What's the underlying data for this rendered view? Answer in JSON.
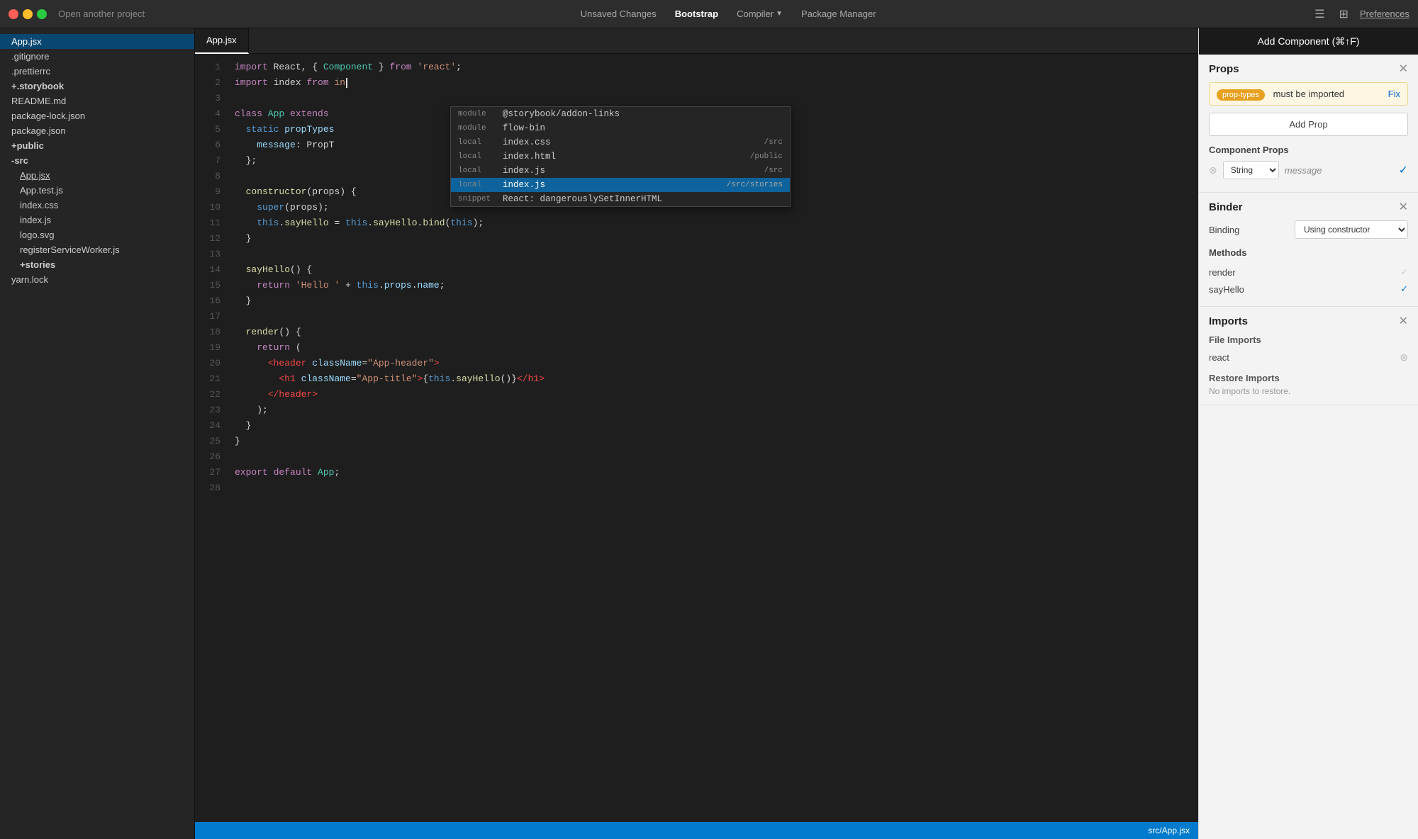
{
  "titlebar": {
    "open_project": "Open another project",
    "tabs": [
      {
        "label": "Unsaved Changes",
        "active": false
      },
      {
        "label": "Bootstrap",
        "active": true
      },
      {
        "label": "Compiler",
        "active": false,
        "has_arrow": true
      },
      {
        "label": "Package Manager",
        "active": false
      }
    ],
    "preferences": "Preferences"
  },
  "sidebar": {
    "items": [
      {
        "label": "App.jsx",
        "level": 0,
        "active": true
      },
      {
        "label": ".gitignore",
        "level": 0
      },
      {
        "label": ".prettierrc",
        "level": 0
      },
      {
        "label": "+.storybook",
        "level": 0,
        "bold": true
      },
      {
        "label": "README.md",
        "level": 0
      },
      {
        "label": "package-lock.json",
        "level": 0
      },
      {
        "label": "package.json",
        "level": 0
      },
      {
        "label": "+public",
        "level": 0,
        "bold": true
      },
      {
        "label": "-src",
        "level": 0,
        "bold": true
      },
      {
        "label": "App.jsx",
        "level": 1,
        "underline": true
      },
      {
        "label": "App.test.js",
        "level": 1
      },
      {
        "label": "index.css",
        "level": 1
      },
      {
        "label": "index.js",
        "level": 1
      },
      {
        "label": "logo.svg",
        "level": 1
      },
      {
        "label": "registerServiceWorker.js",
        "level": 1
      },
      {
        "label": "+stories",
        "level": 1,
        "bold": true
      },
      {
        "label": "yarn.lock",
        "level": 0
      }
    ]
  },
  "editor": {
    "filename": "App.jsx",
    "status_path": "src/App.jsx",
    "lines": [
      {
        "num": 1,
        "code": "import_react_component"
      },
      {
        "num": 2,
        "code": "import_index"
      },
      {
        "num": 3,
        "code": ""
      },
      {
        "num": 4,
        "code": "class_app_extends"
      },
      {
        "num": 5,
        "code": "static_proptypes"
      },
      {
        "num": 6,
        "code": "message_proptype"
      },
      {
        "num": 7,
        "code": "closing_brace_semi"
      },
      {
        "num": 8,
        "code": ""
      },
      {
        "num": 9,
        "code": "constructor_props"
      },
      {
        "num": 10,
        "code": "super_props"
      },
      {
        "num": 11,
        "code": "this_sayhello_bind"
      },
      {
        "num": 12,
        "code": "closing_brace"
      },
      {
        "num": 13,
        "code": ""
      },
      {
        "num": 14,
        "code": "sayhello_fn"
      },
      {
        "num": 15,
        "code": "return_hello"
      },
      {
        "num": 16,
        "code": "closing_brace"
      },
      {
        "num": 17,
        "code": ""
      },
      {
        "num": 18,
        "code": "render_fn"
      },
      {
        "num": 19,
        "code": "return_open"
      },
      {
        "num": 20,
        "code": "header_tag"
      },
      {
        "num": 21,
        "code": "h1_tag"
      },
      {
        "num": 22,
        "code": "header_close"
      },
      {
        "num": 23,
        "code": "paren_close"
      },
      {
        "num": 24,
        "code": "closing_brace"
      },
      {
        "num": 25,
        "code": "closing_brace2"
      },
      {
        "num": 26,
        "code": ""
      },
      {
        "num": 27,
        "code": "export_default"
      },
      {
        "num": 28,
        "code": ""
      }
    ]
  },
  "autocomplete": {
    "items": [
      {
        "type": "module",
        "name": "@storybook/addon-links",
        "path": ""
      },
      {
        "type": "module",
        "name": "flow-bin",
        "path": ""
      },
      {
        "type": "local",
        "name": "index.css",
        "path": "/src"
      },
      {
        "type": "local",
        "name": "index.html",
        "path": "/public"
      },
      {
        "type": "local",
        "name": "index.js",
        "path": "/src"
      },
      {
        "type": "local",
        "name": "index.js",
        "path": "/src/stories",
        "selected": true
      }
    ],
    "snippet_label": "snippet",
    "snippet_name": "React: dangerouslySetInnerHTML"
  },
  "right_panel": {
    "add_component_label": "Add Component (⌘↑F)",
    "props_title": "Props",
    "warning": {
      "badge": "prop-types",
      "message": "must be imported",
      "fix": "Fix"
    },
    "add_prop_label": "Add Prop",
    "component_props_title": "Component Props",
    "prop": {
      "type": "String",
      "name": "message"
    },
    "binder_title": "Binder",
    "binding_label": "Binding",
    "binding_value": "Using constructor",
    "methods_title": "Methods",
    "methods": [
      {
        "name": "render",
        "checked": true,
        "active": false
      },
      {
        "name": "sayHello",
        "checked": true,
        "active": true
      }
    ],
    "imports_title": "Imports",
    "file_imports_title": "File Imports",
    "file_imports": [
      {
        "name": "react"
      }
    ],
    "restore_imports_title": "Restore Imports",
    "restore_imports_note": "No imports to restore."
  }
}
